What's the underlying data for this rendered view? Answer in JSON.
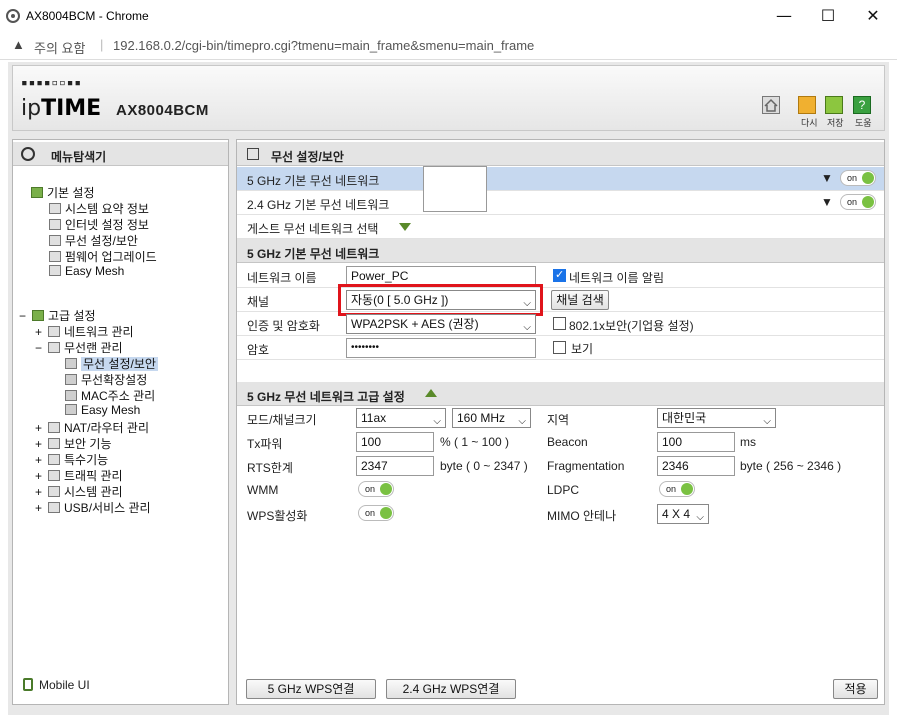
{
  "window": {
    "title": "AX8004BCM - Chrome"
  },
  "address": {
    "not_secure": "주의 요함",
    "url": "192.168.0.2/cgi-bin/timepro.cgi?tmenu=main_frame&smenu=main_frame"
  },
  "header": {
    "logo_top": "▪▪▪▪▫▫▪▪",
    "logo_ip": "ip",
    "logo_time": "TIME",
    "model": "AX8004BCM",
    "buttons": [
      {
        "label": "다시"
      },
      {
        "label": "저장"
      },
      {
        "label": "도움"
      }
    ]
  },
  "left": {
    "title": "메뉴탐색기",
    "basic": {
      "label": "기본 설정",
      "items": [
        "시스템 요약 정보",
        "인터넷 설정 정보",
        "무선 설정/보안",
        "펌웨어 업그레이드",
        "Easy Mesh"
      ]
    },
    "advanced": {
      "label": "고급 설정",
      "items": [
        {
          "toggle": "+",
          "label": "네트워크 관리"
        },
        {
          "toggle": "−",
          "label": "무선랜 관리"
        },
        {
          "toggle": "+",
          "label": "NAT/라우터 관리"
        },
        {
          "toggle": "+",
          "label": "보안 기능"
        },
        {
          "toggle": "+",
          "label": "특수기능"
        },
        {
          "toggle": "+",
          "label": "트래픽 관리"
        },
        {
          "toggle": "+",
          "label": "시스템 관리"
        },
        {
          "toggle": "+",
          "label": "USB/서비스 관리"
        }
      ],
      "wireless_sub": [
        "무선 설정/보안",
        "무선확장설정",
        "MAC주소 관리",
        "Easy Mesh"
      ]
    },
    "mobile": "Mobile UI"
  },
  "right": {
    "title": "무선 설정/보안",
    "net5": "5 GHz 기본 무선 네트워크",
    "net24": "2.4 GHz 기본 무선 네트워크",
    "toggle_on": "on",
    "guest": "게스트 무선 네트워크 선택",
    "basic_title": "5 GHz 기본 무선 네트워크",
    "ssid_label": "네트워크 이름",
    "ssid_value": "Power_PC",
    "ssid_broadcast": "네트워크 이름 알림",
    "channel_label": "채널",
    "channel_value": "자동(0 [ 5.0 GHz ])",
    "channel_search": "채널 검색",
    "auth_label": "인증 및 암호화",
    "auth_value": "WPA2PSK + AES (권장)",
    "enterprise": "802.1x보안(기업용 설정)",
    "pw_label": "암호",
    "pw_value": "••••••••",
    "show": "보기",
    "adv_title": "5 GHz 무선 네트워크 고급 설정",
    "mode_label": "모드/채널크기",
    "mode_value": "11ax",
    "width_value": "160 MHz",
    "region_label": "지역",
    "region_value": "대한민국",
    "tx_label": "Tx파워",
    "tx_value": "100",
    "tx_range": "% ( 1 ~ 100 )",
    "beacon_label": "Beacon",
    "beacon_value": "100",
    "beacon_unit": "ms",
    "rts_label": "RTS한계",
    "rts_value": "2347",
    "rts_range": "byte ( 0 ~ 2347 )",
    "frag_label": "Fragmentation",
    "frag_value": "2346",
    "frag_range": "byte ( 256 ~ 2346 )",
    "wmm_label": "WMM",
    "ldpc_label": "LDPC",
    "wps_label": "WPS활성화",
    "mimo_label": "MIMO 안테나",
    "mimo_value": "4 X 4",
    "wps5_btn": "5 GHz WPS연결",
    "wps24_btn": "2.4 GHz WPS연결",
    "apply_btn": "적용"
  }
}
